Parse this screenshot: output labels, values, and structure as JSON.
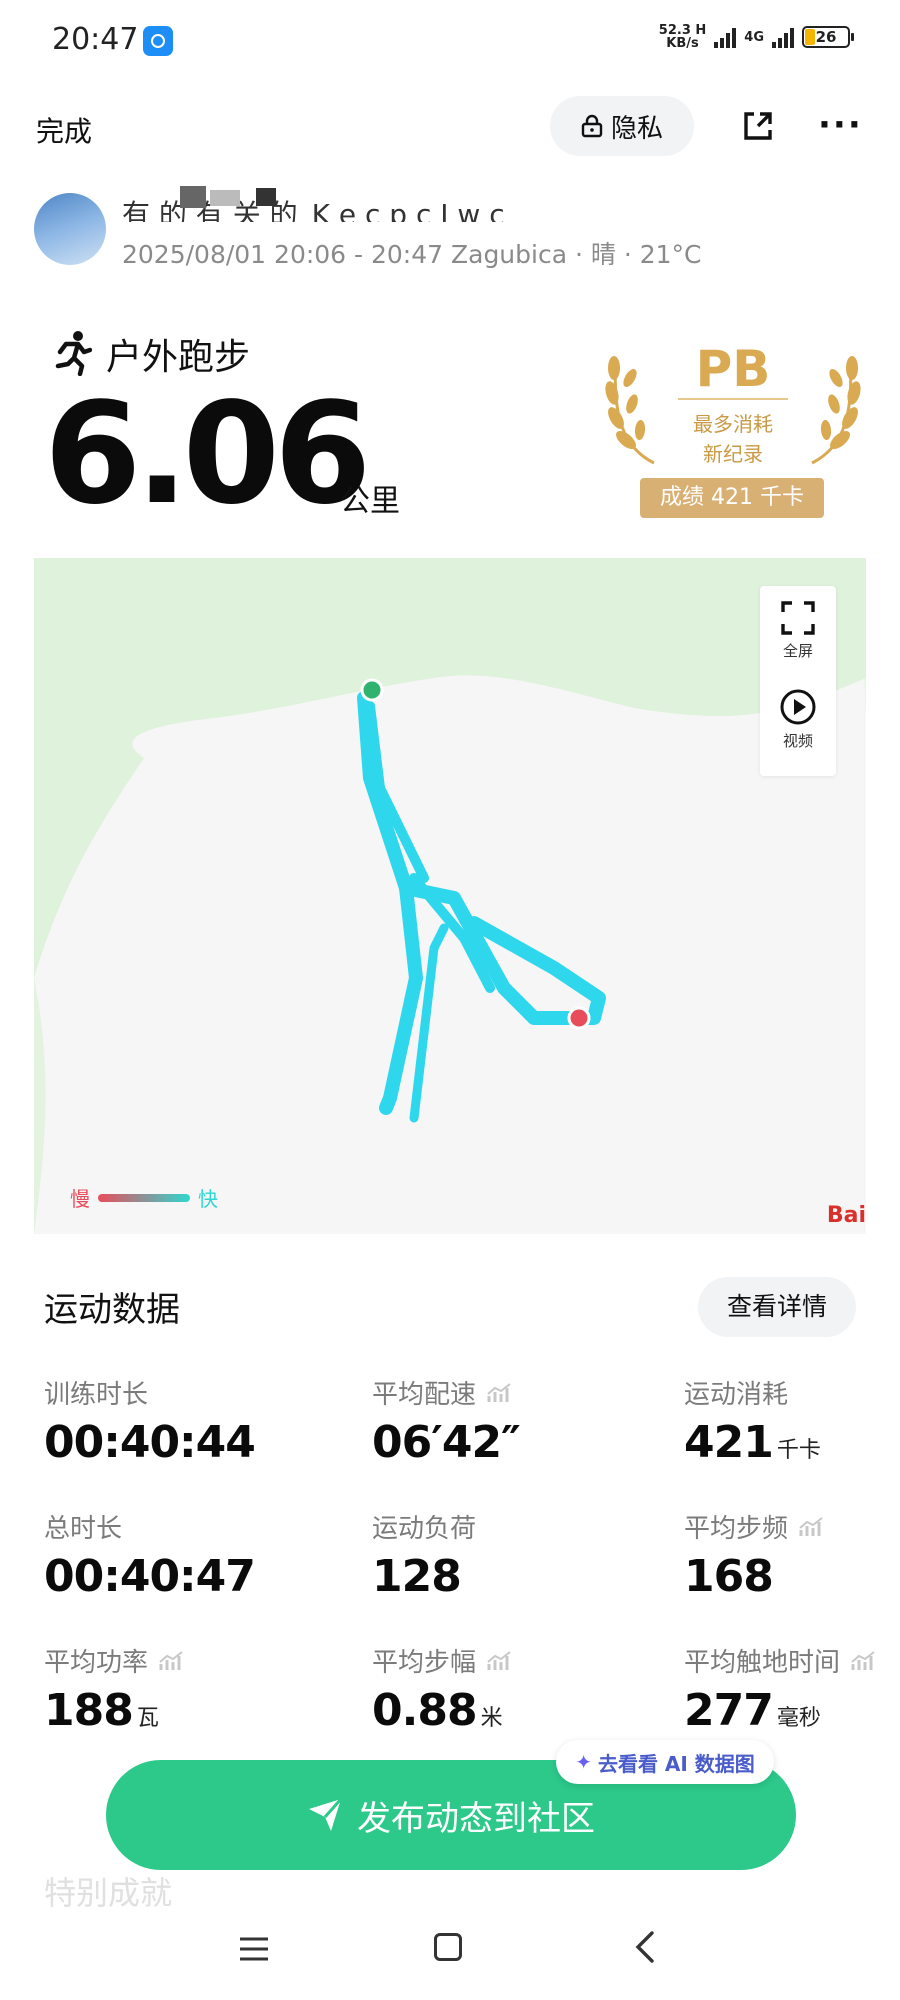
{
  "status_bar": {
    "time": "20:47",
    "net_speed_value": "52.3 H",
    "net_speed_unit": "KB/s",
    "network_type": "4G",
    "battery": "26"
  },
  "top_bar": {
    "done_label": "完成",
    "privacy_label": "隐私",
    "share_icon": "share-icon",
    "more_icon": "more-icon"
  },
  "user": {
    "name": "有 的 有 关 的_K e c p c  J w c",
    "meta": "2025/08/01 20:06 - 20:47 Zagubica · 晴 · 21°C"
  },
  "activity": {
    "type": "户外跑步",
    "distance": "6.06",
    "distance_unit": "公里",
    "badge": {
      "title": "PB",
      "line1": "最多消耗",
      "line2": "新纪录",
      "result": "成绩 421 千卡",
      "color": "#d9aa52"
    }
  },
  "map": {
    "fullscreen_label": "全屏",
    "video_label": "视频",
    "legend_slow": "慢",
    "legend_fast": "快",
    "attribution": "Bai",
    "route_color": "#2fd7ec",
    "start_color": "#2fb36e",
    "end_color": "#e84d5b"
  },
  "stats": {
    "title": "运动数据",
    "details_label": "查看详情",
    "items": [
      {
        "label": "训练时长",
        "value": "00:40:44",
        "unit": ""
      },
      {
        "label": "平均配速",
        "value": "06′42″",
        "unit": ""
      },
      {
        "label": "运动消耗",
        "value": "421",
        "unit": "千卡"
      },
      {
        "label": "总时长",
        "value": "00:40:47",
        "unit": ""
      },
      {
        "label": "运动负荷",
        "value": "128",
        "unit": ""
      },
      {
        "label": "平均步频",
        "value": "168",
        "unit": ""
      },
      {
        "label": "平均功率",
        "value": "188",
        "unit": "瓦"
      },
      {
        "label": "平均步幅",
        "value": "0.88",
        "unit": "米"
      },
      {
        "label": "平均触地时间",
        "value": "277",
        "unit": "毫秒"
      }
    ]
  },
  "ai_chip_label": "去看看 AI 数据图",
  "publish_label": "发布动态到社区",
  "cut_off_text": "特别成就",
  "colors": {
    "accent_green": "#2cc98a",
    "badge_gold": "#d9b073"
  }
}
